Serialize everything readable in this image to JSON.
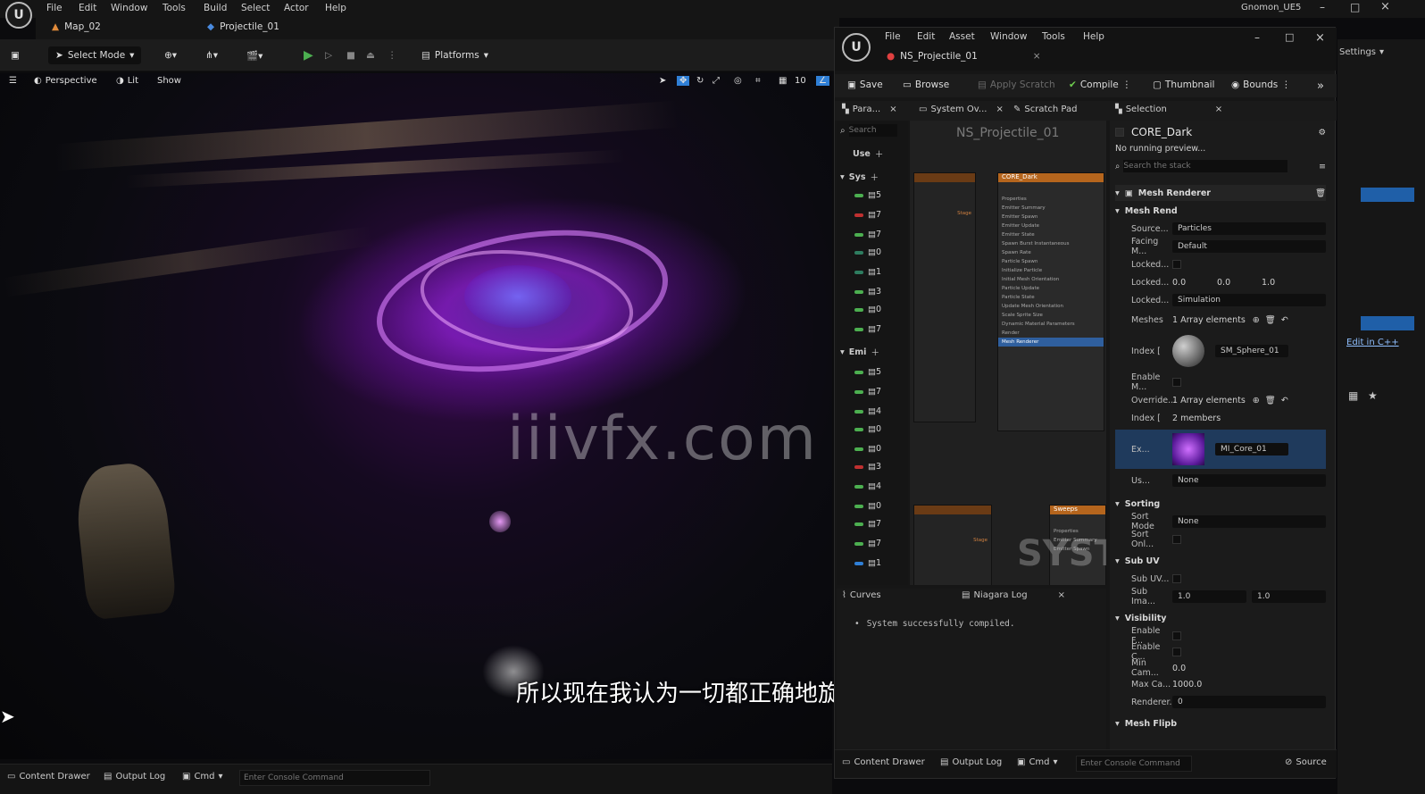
{
  "menubar": {
    "items": [
      "File",
      "Edit",
      "Window",
      "Tools",
      "Build",
      "Select",
      "Actor",
      "Help"
    ],
    "project_name": "Gnomon_UE5"
  },
  "tabs": {
    "map": "Map_02",
    "projectile": "Projectile_01"
  },
  "toolbar": {
    "select_mode": "Select Mode",
    "platforms": "Platforms",
    "settings": "Settings"
  },
  "viewport": {
    "perspective": "Perspective",
    "lit": "Lit",
    "show": "Show",
    "grid_value": "10"
  },
  "subtitle": "所以现在我认为一切都正确地旋转",
  "watermark": "iiivfx.com",
  "statusbar": {
    "content_drawer": "Content Drawer",
    "output_log": "Output Log",
    "cmd": "Cmd",
    "console_placeholder": "Enter Console Command"
  },
  "niagara": {
    "menu": [
      "File",
      "Edit",
      "Asset",
      "Window",
      "Tools",
      "Help"
    ],
    "asset_tab": "NS_Projectile_01",
    "toolbar": {
      "save": "Save",
      "browse": "Browse",
      "apply_scratch": "Apply Scratch",
      "compile": "Compile",
      "thumbnail": "Thumbnail",
      "bounds": "Bounds"
    },
    "panel_tabs": {
      "params": "Para...",
      "system_overview": "System Ov...",
      "scratch_pad": "Scratch Pad",
      "selection": "Selection"
    },
    "params": {
      "search_placeholder": "Search",
      "user": "Use",
      "system": "Sys",
      "emitter": "Emi"
    },
    "graph": {
      "title": "NS_Projectile_01",
      "node_core": "CORE_Dark",
      "node_sweep": "Sweeps",
      "node_lines": [
        "Properties",
        "Emitter Summary",
        "Emitter Spawn",
        "Emitter Update",
        "Emitter State",
        "Spawn Burst Instantaneous",
        "Spawn Rate",
        "Particle Spawn",
        "Initialize Particle",
        "Initial Mesh Orientation",
        "Particle Update",
        "Particle State",
        "Update Mesh Orientation",
        "Scale Sprite Size",
        "Dynamic Material Parameters",
        "Render",
        "Mesh Renderer"
      ],
      "stage": "Stage",
      "watermark": "SYSTEM"
    },
    "log": {
      "curves_tab": "Curves",
      "niagara_log_tab": "Niagara Log",
      "message": "System successfully compiled."
    },
    "details": {
      "selected_name": "CORE_Dark",
      "preview_status": "No running preview...",
      "search_placeholder": "Search the stack",
      "renderer": "Mesh Renderer",
      "mesh_rend_section": "Mesh Rend",
      "source_label": "Source...",
      "source_value": "Particles",
      "facing_label": "Facing M...",
      "facing_value": "Default",
      "locked_label": "Locked...",
      "locked_axis_label": "Locked...",
      "locked_axis_values": [
        "0.0",
        "0.0",
        "1.0"
      ],
      "locked_space_label": "Locked...",
      "locked_space_value": "Simulation",
      "meshes_label": "Meshes",
      "meshes_value": "1 Array elements",
      "index_label": "Index [",
      "mesh_asset": "SM_Sphere_01",
      "enable_mesh_label": "Enable M...",
      "override_label": "Override...",
      "override_value": "1 Array elements",
      "override_index_label": "Index [",
      "override_members": "2 members",
      "ex_label": "Ex...",
      "material": "MI_Core_01",
      "us_label": "Us...",
      "us_value": "None",
      "sorting": "Sorting",
      "sort_mode_label": "Sort Mode",
      "sort_mode_value": "None",
      "sort_only_label": "Sort Onl...",
      "sub_uv": "Sub UV",
      "sub_uv_label": "Sub UV...",
      "sub_image_label": "Sub Ima...",
      "sub_image_values": [
        "1.0",
        "1.0"
      ],
      "visibility": "Visibility",
      "enable_f_label": "Enable F...",
      "enable_c_label": "Enable C...",
      "min_cam_label": "Min Cam...",
      "min_cam_value": "0.0",
      "max_cam_label": "Max Ca...",
      "max_cam_value": "1000.0",
      "renderer_vis_label": "Renderer...",
      "renderer_vis_value": "0",
      "mesh_flip": "Mesh Flipb"
    },
    "status": {
      "content_drawer": "Content Drawer",
      "output_log": "Output Log",
      "cmd": "Cmd",
      "console_placeholder": "Enter Console Command",
      "source": "Source"
    }
  },
  "right_panel": {
    "edit_in_cpp": "Edit in C++"
  },
  "colors": {
    "accent_blue": "#2f7fd6",
    "play_green": "#4caf50",
    "particle_purple": "#a030ff",
    "node_orange": "#b5651d",
    "compile_green": "#6fcf4f"
  }
}
